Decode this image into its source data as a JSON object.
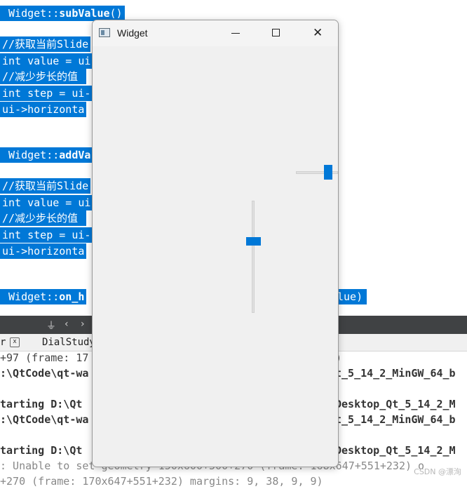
{
  "editor": {
    "lines": [
      {
        "prefix": " Widget::",
        "bold": "subValue",
        "suffix": "()"
      },
      {
        "text": "//获取当前Slide"
      },
      {
        "text": "int value = ui"
      },
      {
        "text": "//减少步长的值 "
      },
      {
        "text": "int step = ui-"
      },
      {
        "text": "ui->horizonta"
      },
      {
        "prefix": " Widget::",
        "bold": "addVa",
        "suffix": ""
      },
      {
        "text": "//获取当前Slide"
      },
      {
        "text": "int value = ui"
      },
      {
        "text": "//减少步长的值 "
      },
      {
        "text": "int step = ui-"
      },
      {
        "text": "ui->horizonta"
      },
      {
        "prefix": " Widget::",
        "bold": "on_h",
        "suffix": ""
      },
      {
        "text": "lue)"
      }
    ]
  },
  "panel": {
    "tab_left": "r",
    "tab_close": "x",
    "tab_right": "DialStudy"
  },
  "output": {
    "lines_left": [
      "+97 (frame: 17",
      ":\\QtCode\\qt-wa",
      "tarting D:\\Qt",
      ":\\QtCode\\qt-wa",
      "tarting D:\\Qt",
      ": Unable to set geometry 150x600+500+270 (frame: 168x647+551+232) o",
      "+270 (frame: 170x647+551+232) margins: 9, 38, 9, 9)"
    ],
    "lines_right": [
      ")",
      "t_5_14_2_MinGW_64_b",
      "Desktop_Qt_5_14_2_M",
      "t_5_14_2_MinGW_64_b",
      "Desktop_Qt_5_14_2_M"
    ]
  },
  "window": {
    "title": "Widget",
    "minimize_label": "minimize",
    "maximize_label": "maximize",
    "close_glyph": "✕"
  },
  "sliders": {
    "horizontal_value_fraction": 0.75,
    "vertical_value_fraction": 0.65
  },
  "watermark": "CSDN @漂洵",
  "colors": {
    "selection": "#0078d7",
    "slider_thumb": "#0078d7",
    "toolbar": "#404244"
  }
}
